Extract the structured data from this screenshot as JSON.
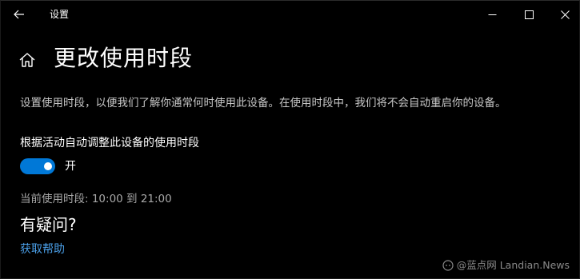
{
  "window": {
    "title": "设置"
  },
  "header": {
    "title": "更改使用时段"
  },
  "content": {
    "description": "设置使用时段，以便我们了解你通常何时使用此设备。在使用时段中，我们将不会自动重启你的设备。",
    "auto_adjust_label": "根据活动自动调整此设备的使用时段",
    "toggle": {
      "on": true,
      "state_label": "开"
    },
    "current_hours": "当前使用时段: 10:00 到 21:00",
    "question_heading": "有疑问?",
    "help_link": "获取帮助"
  },
  "watermark": {
    "text": "@蓝点网 Landian.News"
  },
  "colors": {
    "background": "#000000",
    "accent": "#0078d7",
    "link": "#4a9fe8",
    "secondary_text": "#c8c8c8"
  },
  "icons": {
    "back": "arrow-left-icon",
    "home": "home-icon",
    "minimize": "minimize-icon",
    "maximize": "maximize-icon",
    "close": "close-icon"
  }
}
